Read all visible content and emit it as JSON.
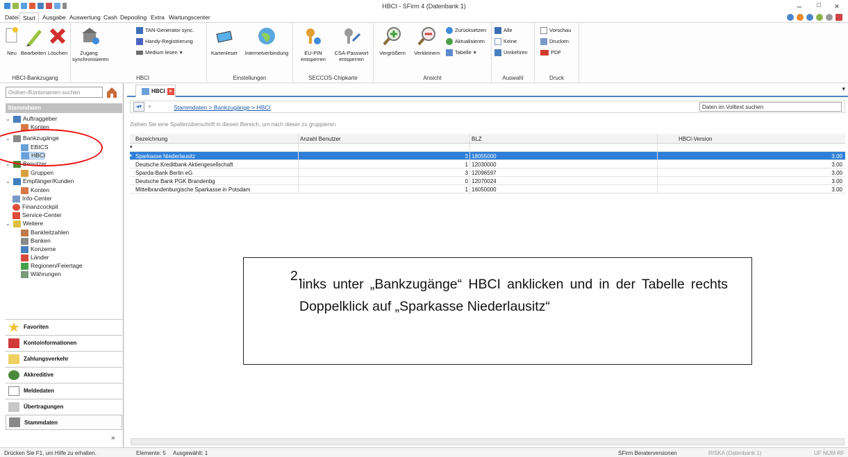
{
  "window": {
    "title": "HBCI - SFirm 4 (Datenbank 1)"
  },
  "menu": [
    "Datei",
    "Start",
    "Ausgabe",
    "Auswertung",
    "Cash",
    "Depooling",
    "Extra",
    "Wartungscenter"
  ],
  "ribbon": {
    "groups": [
      "HBCI-Bankzugang",
      "HBCI",
      "Einstellungen",
      "SECCOS-Chipkarte",
      "Ansicht",
      "Auswahl",
      "Druck"
    ],
    "neu": "Neu",
    "bearbeiten": "Bearbeiten",
    "loeschen": "Löschen",
    "zugang": "Zugang",
    "synchronisieren": "synchronisieren",
    "tan_generator": "TAN-Generator sync.",
    "handy": "Handy-Registrierung",
    "medium": "Medium lesen",
    "kartenleser": "Kartenleser",
    "internetverbindung": "Internetverbindung",
    "eu_pin": "EU-PIN",
    "entsperren1": "entsperren",
    "csa_passwort": "CSA-Passwort",
    "entsperren2": "entsperren",
    "vergroessern": "Vergrößern",
    "verkleinern": "Verkleinern",
    "zuruecksetzen": "Zurücksetzen",
    "aktualisieren": "Aktualisieren",
    "tabelle": "Tabelle",
    "alle": "Alle",
    "keine": "Keine",
    "umkehren": "Umkehren",
    "vorschau": "Vorschau",
    "drucken": "Drucken",
    "pdf": "PDF"
  },
  "left": {
    "search_placeholder": "Ordner-/Kontonamen suchen",
    "section": "Stammdaten",
    "tree": {
      "auftraggeber": "Auftraggeber",
      "auftraggeber_konten": "Konten",
      "bankzugaenge": "Bankzugänge",
      "ebics": "EBICS",
      "hbci": "HBCI",
      "benutzer": "Benutzer",
      "gruppen": "Gruppen",
      "empfaenger": "Empfänger/Kunden",
      "empfaenger_konten": "Konten",
      "info_center": "Info-Center",
      "finanzcockpit": "Finanzcockpit",
      "service_center": "Service-Center",
      "weitere": "Weitere",
      "bankleitzahlen": "Bankleitzahlen",
      "banken": "Banken",
      "konzerne": "Konzerne",
      "laender": "Länder",
      "regionen": "Regionen/Feiertage",
      "waehrungen": "Währungen"
    },
    "nav": [
      "Favoriten",
      "Kontoinformationen",
      "Zahlungsverkehr",
      "Akkreditive",
      "Meldedaten",
      "Übertragungen",
      "Stammdaten"
    ]
  },
  "main": {
    "tab": "HBCI",
    "breadcrumb": "Stammdaten > Bankzugänge > HBCI",
    "fulltext_placeholder": "Daten im Volltext suchen",
    "group_hint": "Ziehen Sie eine Spaltenüberschrift in diesen Bereich, um nach dieser zu gruppieren",
    "columns": [
      "Bezeichnung",
      "Anzahl Benutzer",
      "BLZ",
      "HBCI-Version"
    ],
    "rows": [
      [
        "Sparkasse Niederlausitz",
        "3",
        "18055000",
        "3.00"
      ],
      [
        "Deutsche Kreditbank Aktiengesellschaft",
        "1",
        "12030000",
        "3.00"
      ],
      [
        "Sparda-Bank Berlin eG",
        "3",
        "12096597",
        "3.00"
      ],
      [
        "Deutsche Bank PGK Brandenbg",
        "0",
        "12070024",
        "3.00"
      ],
      [
        "Mittelbrandenburgische Sparkasse in Potsdam",
        "1",
        "16050000",
        "3.00"
      ]
    ]
  },
  "annotation": {
    "number": "2.",
    "text": "links unter „Bankzugänge“ HBCI anklicken und in der Tabelle rechts Doppelklick auf „Sparkasse Niederlausitz“"
  },
  "status": {
    "help": "Drücken Sie F1, um Hilfe zu erhalten.",
    "elements": "Elemente: 5",
    "selected": "Ausgewählt: 1",
    "version": "SFirm Beraterversionen",
    "db": "RISKA (Datenbank 1)",
    "flags": "UF NUM RF"
  },
  "colors": {
    "accent": "#2f7fd8",
    "annot_ellipse": "#e11111"
  }
}
